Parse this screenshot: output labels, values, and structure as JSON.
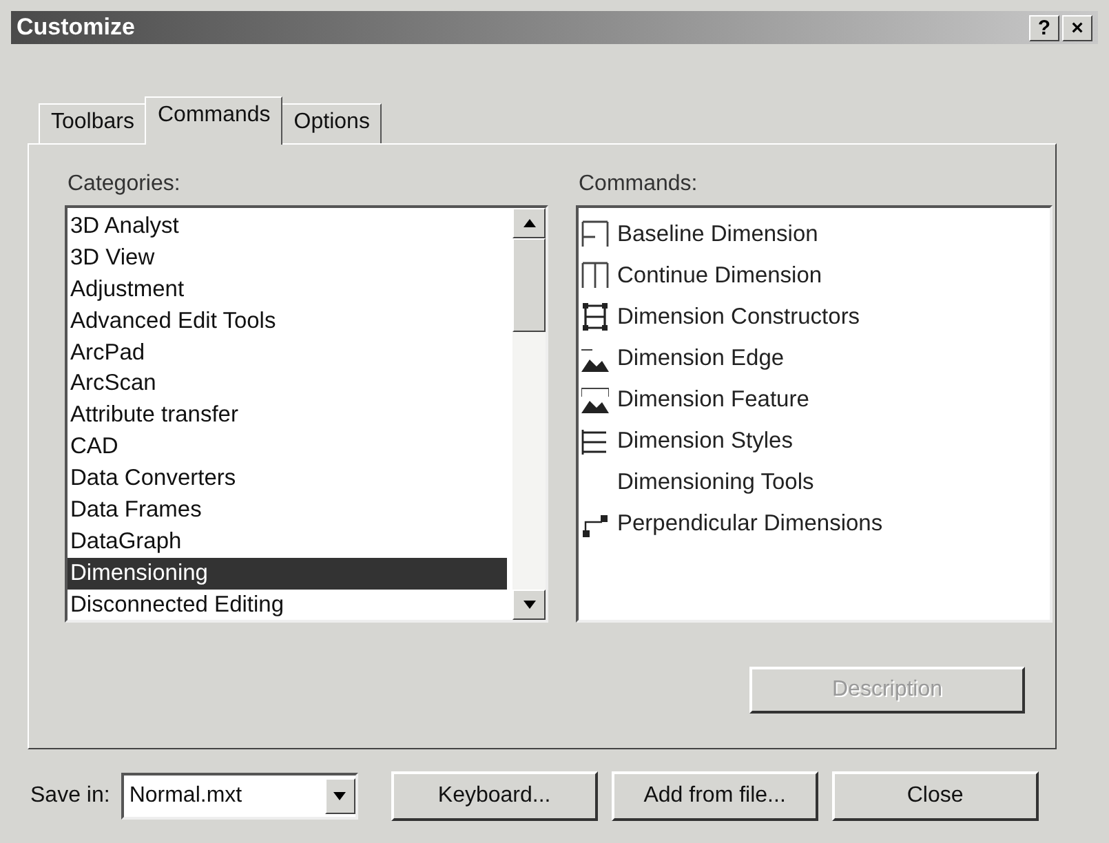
{
  "window": {
    "title": "Customize",
    "help_button": "?",
    "close_button": "×"
  },
  "tabs": [
    {
      "label": "Toolbars",
      "selected": false
    },
    {
      "label": "Commands",
      "selected": true
    },
    {
      "label": "Options",
      "selected": false
    }
  ],
  "categories": {
    "label": "Categories:",
    "items": [
      {
        "label": "3D Analyst",
        "selected": false
      },
      {
        "label": "3D View",
        "selected": false
      },
      {
        "label": "Adjustment",
        "selected": false
      },
      {
        "label": "Advanced Edit Tools",
        "selected": false
      },
      {
        "label": "ArcPad",
        "selected": false
      },
      {
        "label": "ArcScan",
        "selected": false
      },
      {
        "label": "Attribute transfer",
        "selected": false
      },
      {
        "label": "CAD",
        "selected": false
      },
      {
        "label": "Data Converters",
        "selected": false
      },
      {
        "label": "Data Frames",
        "selected": false
      },
      {
        "label": "DataGraph",
        "selected": false
      },
      {
        "label": "Dimensioning",
        "selected": true
      },
      {
        "label": "Disconnected Editing",
        "selected": false
      }
    ]
  },
  "commands": {
    "label": "Commands:",
    "items": [
      {
        "label": "Baseline Dimension",
        "kind": "baseline"
      },
      {
        "label": "Continue Dimension",
        "kind": "continue"
      },
      {
        "label": "Dimension Constructors",
        "kind": "constructors"
      },
      {
        "label": "Dimension Edge",
        "kind": "edge"
      },
      {
        "label": "Dimension Feature",
        "kind": "feature"
      },
      {
        "label": "Dimension Styles",
        "kind": "styles"
      },
      {
        "label": "Dimensioning Tools",
        "kind": "menu"
      },
      {
        "label": "Perpendicular Dimensions",
        "kind": "perpendicular"
      }
    ]
  },
  "description_button": {
    "label": "Description",
    "disabled": true
  },
  "save_in": {
    "label": "Save in:",
    "value": "Normal.mxt"
  },
  "buttons": [
    "Keyboard...",
    "Add from file...",
    "Close"
  ]
}
